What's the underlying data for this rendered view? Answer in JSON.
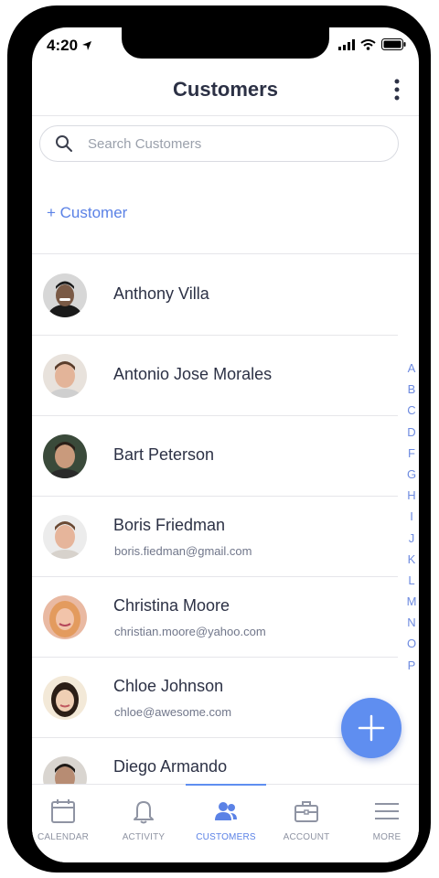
{
  "status_bar": {
    "time": "4:20"
  },
  "header": {
    "title": "Customers"
  },
  "search": {
    "placeholder": "Search Customers",
    "value": ""
  },
  "add_customer_label": "+ Customer",
  "customers": [
    {
      "name": "Anthony Villa",
      "email": ""
    },
    {
      "name": "Antonio Jose Morales",
      "email": ""
    },
    {
      "name": "Bart Peterson",
      "email": ""
    },
    {
      "name": "Boris Friedman",
      "email": "boris.fiedman@gmail.com"
    },
    {
      "name": "Christina Moore",
      "email": "christian.moore@yahoo.com"
    },
    {
      "name": "Chloe Johnson",
      "email": "chloe@awesome.com"
    },
    {
      "name": "Diego Armando",
      "email": ""
    }
  ],
  "alphabet_index": [
    "A",
    "B",
    "C",
    "D",
    "F",
    "G",
    "H",
    "I",
    "J",
    "K",
    "L",
    "M",
    "N",
    "O",
    "P"
  ],
  "tabs": [
    {
      "label": "CALENDAR",
      "icon": "calendar-icon",
      "active": false
    },
    {
      "label": "ACTIVITY",
      "icon": "bell-icon",
      "active": false
    },
    {
      "label": "CUSTOMERS",
      "icon": "users-icon",
      "active": true
    },
    {
      "label": "ACCOUNT",
      "icon": "briefcase-icon",
      "active": false
    },
    {
      "label": "MORE",
      "icon": "hamburger-icon",
      "active": false
    }
  ],
  "colors": {
    "accent": "#5b82e6",
    "fab": "#5f8ef0",
    "text": "#2c3145",
    "muted": "#8f94a3"
  }
}
